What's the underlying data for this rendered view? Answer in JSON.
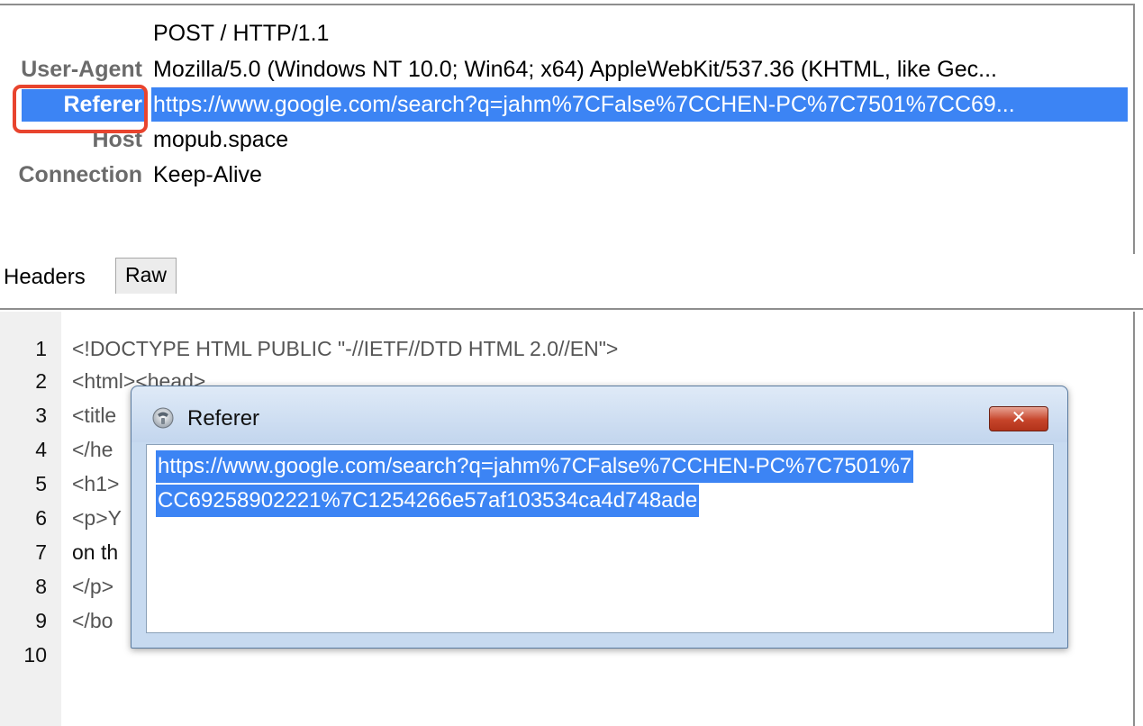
{
  "headers": {
    "rows": [
      {
        "name": "",
        "value": "POST / HTTP/1.1"
      },
      {
        "name": "User-Agent",
        "value": "Mozilla/5.0 (Windows NT 10.0; Win64; x64) AppleWebKit/537.36 (KHTML, like Gec..."
      },
      {
        "name": "Referer",
        "value": "https://www.google.com/search?q=jahm%7CFalse%7CCHEN-PC%7C7501%7CC69..."
      },
      {
        "name": "Host",
        "value": "mopub.space"
      },
      {
        "name": "Connection",
        "value": "Keep-Alive"
      }
    ],
    "selected_index": 2
  },
  "tabs": {
    "headers_label": "Headers",
    "raw_label": "Raw"
  },
  "code": {
    "lines": [
      {
        "num": "1",
        "text": "<!DOCTYPE HTML PUBLIC \"-//IETF//DTD HTML 2.0//EN\">"
      },
      {
        "num": "2",
        "text": "<html><head>"
      },
      {
        "num": "3",
        "text": "<title"
      },
      {
        "num": "4",
        "text": "</he"
      },
      {
        "num": "5",
        "text": "<h1>"
      },
      {
        "num": "6",
        "text": "<p>Y"
      },
      {
        "num": "7",
        "text": "on th"
      },
      {
        "num": "8",
        "text": "</p>"
      },
      {
        "num": "9",
        "text": "</bo"
      },
      {
        "num": "10",
        "text": ""
      }
    ]
  },
  "dialog": {
    "title": "Referer",
    "close_label": "✕",
    "lines": [
      "https://www.google.com/search?q=jahm%7CFalse%7CCHEN-PC%7C7501%7",
      "CC69258902221%7C1254266e57af103534ca4d748ade"
    ]
  },
  "colors": {
    "selection": "#3c84f4",
    "callout": "#e8442e",
    "header_name": "#6b6b6b",
    "dialog_frame": "#c7daf0"
  },
  "icons": {
    "app": "app-icon",
    "close": "close-icon"
  }
}
